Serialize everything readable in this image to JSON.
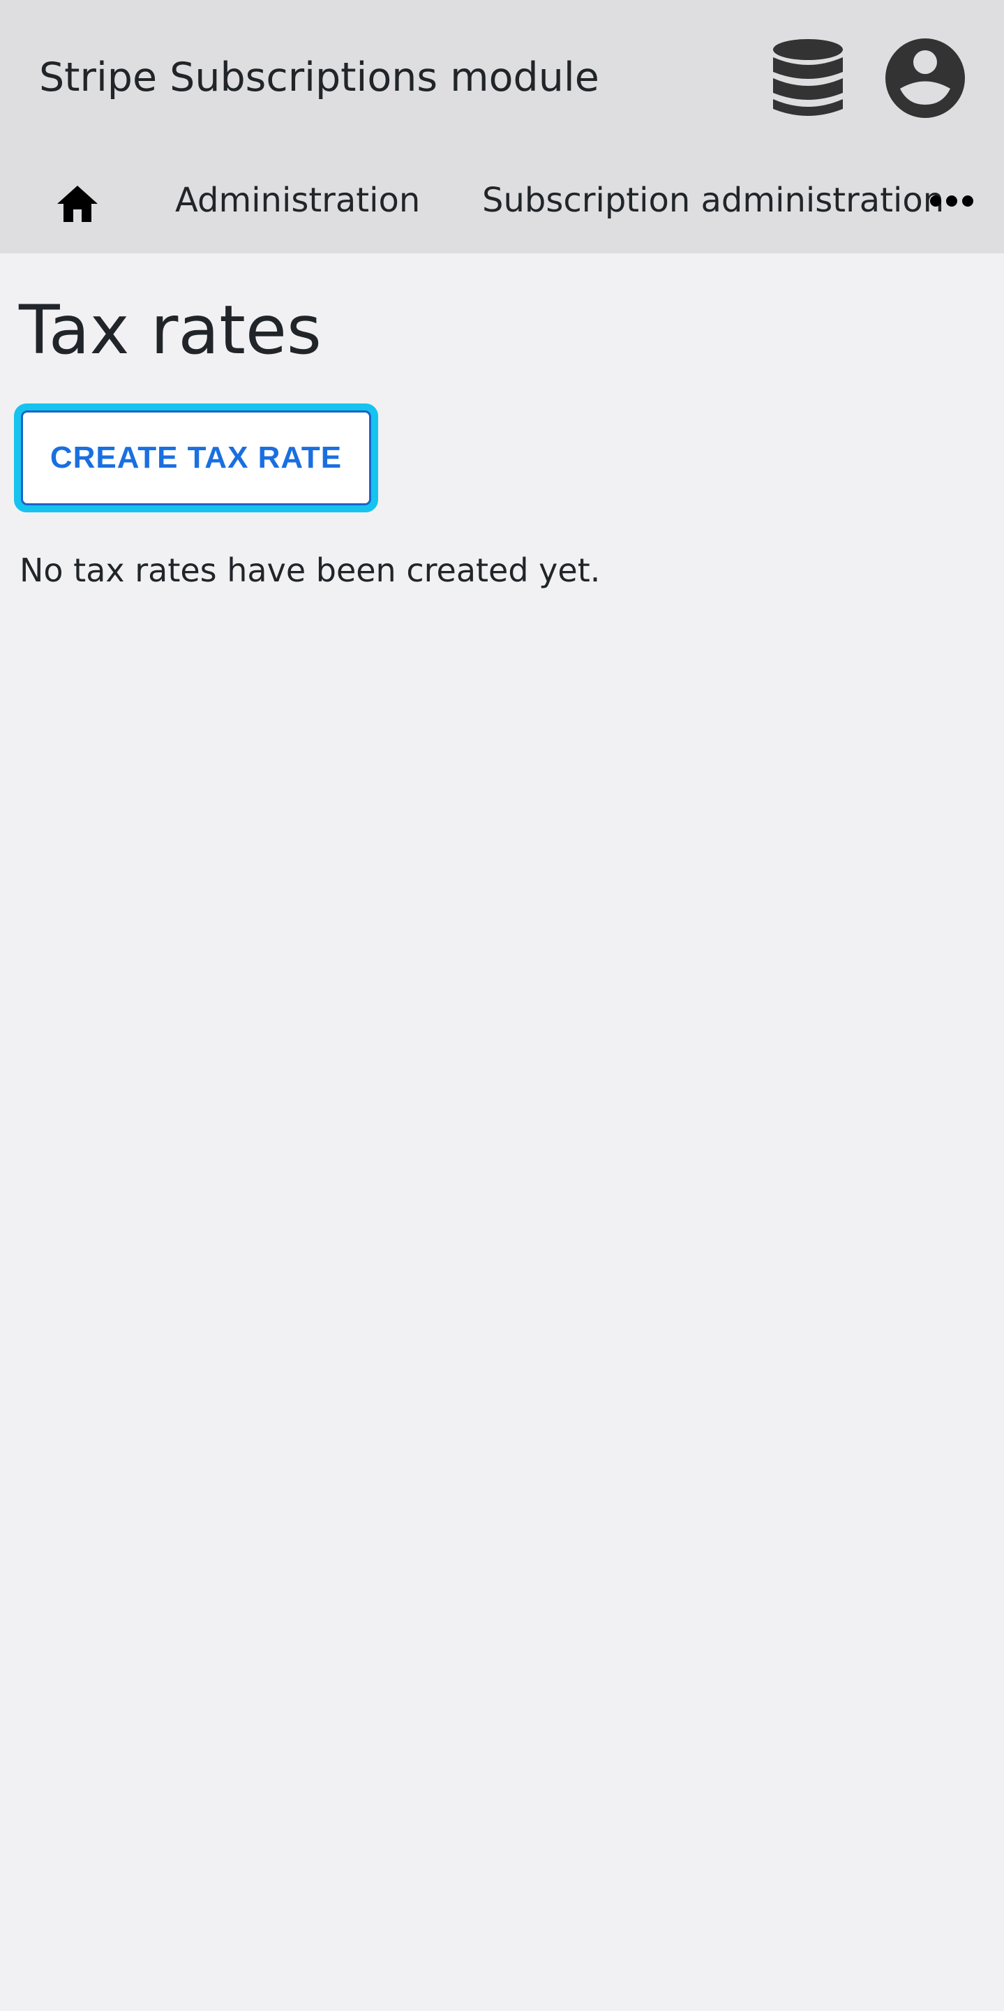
{
  "app": {
    "title": "Stripe Subscriptions module",
    "icons": {
      "database": "database-icon",
      "account": "account-circle-icon"
    },
    "icon_color": "#333333"
  },
  "breadcrumb": {
    "home_icon": "home-icon",
    "items": [
      {
        "label": "Administration"
      },
      {
        "label": "Subscription administration"
      }
    ],
    "more_icon": "more-horizontal-icon"
  },
  "page": {
    "title": "Tax rates",
    "create_button_label": "CREATE TAX RATE",
    "empty_message": "No tax rates have been created yet."
  },
  "colors": {
    "header_bg": "#dedee0",
    "page_bg": "#f1f1f3",
    "button_text": "#1a6fe0",
    "focus_ring": "#16c3ee"
  }
}
